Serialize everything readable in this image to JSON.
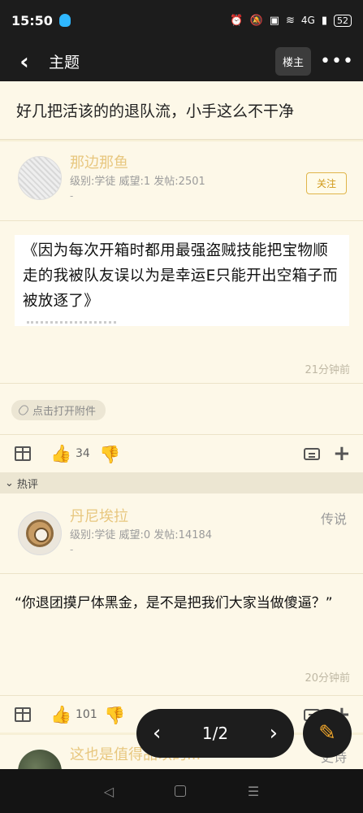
{
  "status": {
    "time": "15:50",
    "network": "4G",
    "battery": "52"
  },
  "topbar": {
    "back_icon": "‹",
    "title": "主题",
    "louzhu_label": "楼主",
    "more_icon": "•••"
  },
  "thread": {
    "title": "好几把活该的的退队流，小手这么不干净"
  },
  "post1": {
    "username": "那边那鱼",
    "meta": "级别:学徒 威望:1 发帖:2501",
    "dash": "-",
    "follow_label": "关注",
    "image_text": "《因为每次开箱时都用最强盗贼技能把宝物顺走的我被队友误以为是幸运E只能开出空箱子而被放逐了》",
    "time": "21分钟前",
    "attachment_label": "点击打开附件",
    "like_count": "34"
  },
  "hot_section": {
    "label": "热评"
  },
  "post2": {
    "username": "丹尼埃拉",
    "meta": "级别:学徒 威望:0 发帖:14184",
    "dash": "-",
    "medal": "传说",
    "content": "“你退团摸尸体黑金，是不是把我们大家当做傻逼？”",
    "time": "20分钟前",
    "like_count": "101"
  },
  "post3": {
    "username": "这也是值得品以的...",
    "medal": "史诗"
  },
  "pager": {
    "label": "1/2",
    "prev": "‹",
    "next": "›"
  },
  "fab": {
    "icon": "✎"
  }
}
